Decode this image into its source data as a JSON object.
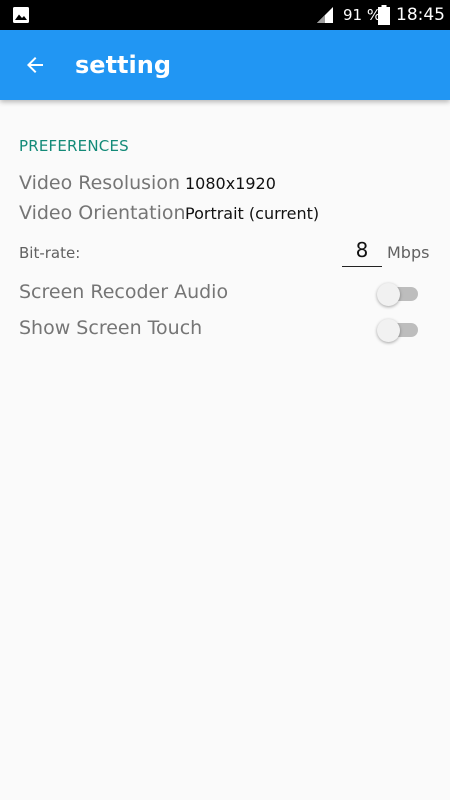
{
  "status_bar": {
    "battery": "91 %",
    "time": "18:45",
    "icons": [
      "gallery-icon",
      "signal-icon",
      "battery-icon"
    ]
  },
  "app_bar": {
    "title": "setting",
    "back_icon": "arrow-back-icon"
  },
  "preferences": {
    "header": "PREFERENCES",
    "video_resolution": {
      "label": "Video Resolusion",
      "value": "1080x1920"
    },
    "video_orientation": {
      "label": "Video Orientation",
      "value": "Portrait (current)"
    },
    "bitrate": {
      "label": "Bit-rate:",
      "value": "8",
      "unit": "Mbps"
    },
    "screen_audio": {
      "label": "Screen Recoder Audio",
      "enabled": false
    },
    "show_touch": {
      "label": "Show Screen Touch",
      "enabled": false
    }
  },
  "colors": {
    "primary": "#2196f3",
    "accent": "#138a78",
    "background": "#fafafa"
  }
}
